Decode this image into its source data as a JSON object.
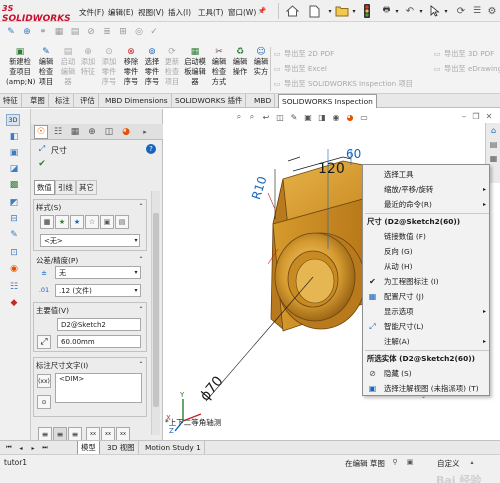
{
  "app": {
    "brand": "SOLIDWORKS",
    "brand_prefix": "3S"
  },
  "menu": {
    "items": [
      "文件(F)",
      "编辑(E)",
      "视图(V)",
      "插入(I)",
      "工具(T)",
      "窗口(W)"
    ]
  },
  "ribbon": {
    "buttons": [
      {
        "label": "新建检\n查项目\n(amp;N)",
        "enabled": true
      },
      {
        "label": "编辑\n检查\n项目",
        "enabled": true
      },
      {
        "label": "启动\n编辑\n器",
        "enabled": false
      },
      {
        "label": "添加\n特征",
        "enabled": false
      },
      {
        "label": "添加\n零件\n序号",
        "enabled": false
      },
      {
        "label": "移除\n零件\n序号",
        "enabled": true
      },
      {
        "label": "选择\n零件\n序号",
        "enabled": true
      },
      {
        "label": "更新\n检查\n项目",
        "enabled": false
      },
      {
        "label": "启动模\n板编辑\n器",
        "enabled": true
      },
      {
        "label": "编辑\n检查\n方式",
        "enabled": true
      },
      {
        "label": "编辑\n操作",
        "enabled": true
      },
      {
        "label": "编辑\n实方",
        "enabled": true
      }
    ],
    "exports": [
      "导出至 2D PDF",
      "导出至 Excel",
      "导出至 SOLIDWORKS Inspection 项目",
      "导出至 3D PDF",
      "导出至 eDrawing"
    ]
  },
  "tabs": [
    "特征",
    "草图",
    "标注",
    "评估",
    "MBD Dimensions",
    "SOLIDWORKS 插件",
    "MBD",
    "SOLIDWORKS Inspection"
  ],
  "active_tab_index": 7,
  "property_manager": {
    "title": "尺寸",
    "subtabs": [
      "数值",
      "引线",
      "其它"
    ],
    "style_label": "样式(S)",
    "style_value": "<无>",
    "tolerance_label": "公差/精度(P)",
    "tolerance_value": "无",
    "precision_value": ".12 (文件)",
    "primary_label": "主要值(V)",
    "primary_name": "D2@Sketch2",
    "primary_value": "60.00mm",
    "text_label": "标注尺寸文字(I)",
    "text_value": "<DIM>"
  },
  "viewport": {
    "dim_top": "60",
    "dim_mid": "120",
    "dim_left": "R10",
    "dim_dia": "ϕ70",
    "view_name": "*上下二等角轴测"
  },
  "context_menu": {
    "items": [
      {
        "label": "选择工具",
        "head": false
      },
      {
        "label": "缩放/平移/旋转",
        "head": false
      },
      {
        "label": "最近的命令(R)",
        "head": false
      },
      {
        "label": "尺寸 (D2@Sketch2(60))",
        "head": true
      },
      {
        "label": "链接数值 (F)",
        "head": false
      },
      {
        "label": "反向 (G)",
        "head": false
      },
      {
        "label": "从动 (H)",
        "head": false
      },
      {
        "label": "为工程图标注 (I)",
        "head": false
      },
      {
        "label": "配置尺寸 (J)",
        "head": false
      },
      {
        "label": "显示选项",
        "head": false
      },
      {
        "label": "智能尺寸(L)",
        "head": false
      },
      {
        "label": "注解(A)",
        "head": false
      },
      {
        "label": "所选实体 (D2@Sketch2(60))",
        "head": true
      },
      {
        "label": "隐藏 (S)",
        "head": false
      },
      {
        "label": "选择注解视图 (未指派项) (T)",
        "head": false
      }
    ]
  },
  "bottom_tabs": [
    "模型",
    "3D 视图",
    "Motion Study 1"
  ],
  "status": {
    "left": "tutor1",
    "editing": "在编辑 草图",
    "custom": "自定义"
  },
  "watermark": "Bai 经验"
}
